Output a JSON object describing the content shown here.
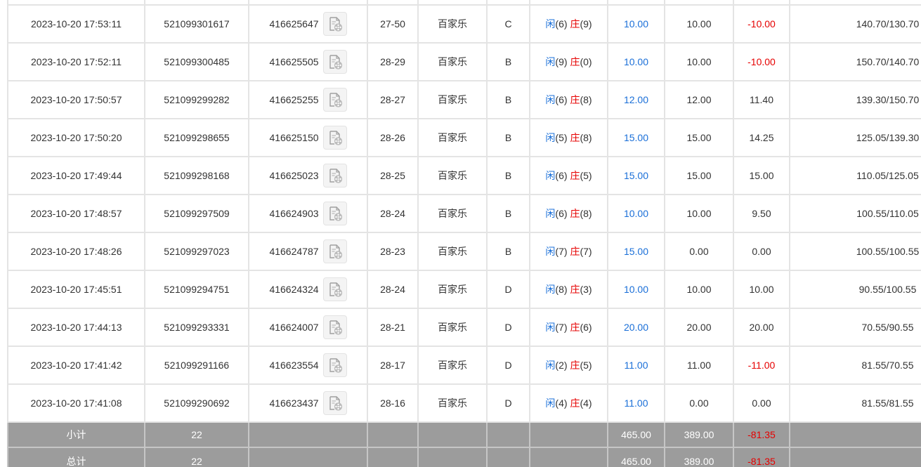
{
  "colors": {
    "text": "#333333",
    "blue": "#1a6fd8",
    "red": "#e60000",
    "border": "#e4e4e4",
    "footer_bg": "#9c9c9c",
    "footer_text": "#ffffff",
    "footer_border": "#c6c6c6",
    "icon_bg": "#f4f4f4"
  },
  "icons": {
    "replay": "video-replay-icon"
  },
  "result_labels": {
    "player": "闲",
    "banker": "庄"
  },
  "rows": [
    {
      "time": "2023-10-20 17:53:11",
      "bet_id": "521099301617",
      "round_id": "416625647",
      "table": "27-50",
      "game": "百家乐",
      "bet_type": "C",
      "player_score": "(6)",
      "banker_score": "(9)",
      "bet_amount": "10.00",
      "valid_bet": "10.00",
      "win_loss": "-10.00",
      "balance": "140.70/130.70"
    },
    {
      "time": "2023-10-20 17:52:11",
      "bet_id": "521099300485",
      "round_id": "416625505",
      "table": "28-29",
      "game": "百家乐",
      "bet_type": "B",
      "player_score": "(9)",
      "banker_score": "(0)",
      "bet_amount": "10.00",
      "valid_bet": "10.00",
      "win_loss": "-10.00",
      "balance": "150.70/140.70"
    },
    {
      "time": "2023-10-20 17:50:57",
      "bet_id": "521099299282",
      "round_id": "416625255",
      "table": "28-27",
      "game": "百家乐",
      "bet_type": "B",
      "player_score": "(6)",
      "banker_score": "(8)",
      "bet_amount": "12.00",
      "valid_bet": "12.00",
      "win_loss": "11.40",
      "balance": "139.30/150.70"
    },
    {
      "time": "2023-10-20 17:50:20",
      "bet_id": "521099298655",
      "round_id": "416625150",
      "table": "28-26",
      "game": "百家乐",
      "bet_type": "B",
      "player_score": "(5)",
      "banker_score": "(8)",
      "bet_amount": "15.00",
      "valid_bet": "15.00",
      "win_loss": "14.25",
      "balance": "125.05/139.30"
    },
    {
      "time": "2023-10-20 17:49:44",
      "bet_id": "521099298168",
      "round_id": "416625023",
      "table": "28-25",
      "game": "百家乐",
      "bet_type": "B",
      "player_score": "(6)",
      "banker_score": "(5)",
      "bet_amount": "15.00",
      "valid_bet": "15.00",
      "win_loss": "15.00",
      "balance": "110.05/125.05"
    },
    {
      "time": "2023-10-20 17:48:57",
      "bet_id": "521099297509",
      "round_id": "416624903",
      "table": "28-24",
      "game": "百家乐",
      "bet_type": "B",
      "player_score": "(6)",
      "banker_score": "(8)",
      "bet_amount": "10.00",
      "valid_bet": "10.00",
      "win_loss": "9.50",
      "balance": "100.55/110.05"
    },
    {
      "time": "2023-10-20 17:48:26",
      "bet_id": "521099297023",
      "round_id": "416624787",
      "table": "28-23",
      "game": "百家乐",
      "bet_type": "B",
      "player_score": "(7)",
      "banker_score": "(7)",
      "bet_amount": "15.00",
      "valid_bet": "0.00",
      "win_loss": "0.00",
      "balance": "100.55/100.55"
    },
    {
      "time": "2023-10-20 17:45:51",
      "bet_id": "521099294751",
      "round_id": "416624324",
      "table": "28-24",
      "game": "百家乐",
      "bet_type": "D",
      "player_score": "(8)",
      "banker_score": "(3)",
      "bet_amount": "10.00",
      "valid_bet": "10.00",
      "win_loss": "10.00",
      "balance": "90.55/100.55"
    },
    {
      "time": "2023-10-20 17:44:13",
      "bet_id": "521099293331",
      "round_id": "416624007",
      "table": "28-21",
      "game": "百家乐",
      "bet_type": "D",
      "player_score": "(7)",
      "banker_score": "(6)",
      "bet_amount": "20.00",
      "valid_bet": "20.00",
      "win_loss": "20.00",
      "balance": "70.55/90.55"
    },
    {
      "time": "2023-10-20 17:41:42",
      "bet_id": "521099291166",
      "round_id": "416623554",
      "table": "28-17",
      "game": "百家乐",
      "bet_type": "D",
      "player_score": "(2)",
      "banker_score": "(5)",
      "bet_amount": "11.00",
      "valid_bet": "11.00",
      "win_loss": "-11.00",
      "balance": "81.55/70.55"
    },
    {
      "time": "2023-10-20 17:41:08",
      "bet_id": "521099290692",
      "round_id": "416623437",
      "table": "28-16",
      "game": "百家乐",
      "bet_type": "D",
      "player_score": "(4)",
      "banker_score": "(4)",
      "bet_amount": "11.00",
      "valid_bet": "0.00",
      "win_loss": "0.00",
      "balance": "81.55/81.55"
    }
  ],
  "summary": [
    {
      "label": "小计",
      "count": "22",
      "bet_amount": "465.00",
      "valid_bet": "389.00",
      "win_loss": "-81.35"
    },
    {
      "label": "总计",
      "count": "22",
      "bet_amount": "465.00",
      "valid_bet": "389.00",
      "win_loss": "-81.35"
    }
  ]
}
